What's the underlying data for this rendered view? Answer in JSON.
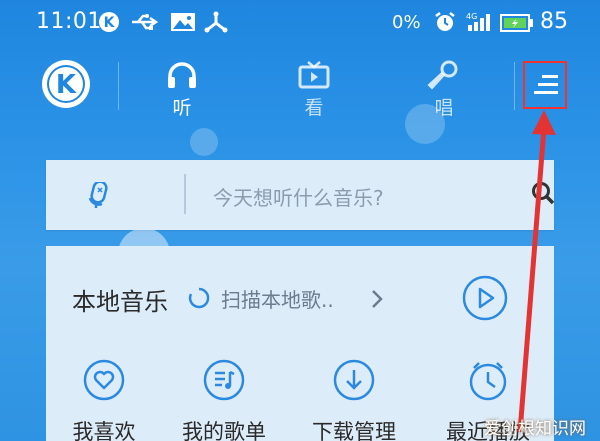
{
  "status_bar": {
    "time": "11:01",
    "data_rate": "0%",
    "battery_level": "85",
    "icons": [
      "k-app-icon",
      "usb-icon",
      "image-icon",
      "share-icon",
      "alarm-icon",
      "signal-4g-icon",
      "battery-icon"
    ]
  },
  "nav": {
    "logo": "K",
    "tabs": [
      {
        "label": "听",
        "icon": "headphones-icon",
        "active": true
      },
      {
        "label": "看",
        "icon": "tv-icon",
        "active": false
      },
      {
        "label": "唱",
        "icon": "microphone-icon",
        "active": false
      }
    ],
    "menu_icon": "menu-icon"
  },
  "search": {
    "placeholder": "今天想听什么音乐?",
    "left_icon": "voice-search-icon",
    "right_icon": "search-icon"
  },
  "local_music": {
    "title": "本地音乐",
    "scan_text": "扫描本地歌..",
    "chevron_icon": "chevron-right-icon",
    "play_icon": "play-circle-icon"
  },
  "quick_actions": [
    {
      "label": "我喜欢",
      "icon": "heart-icon"
    },
    {
      "label": "我的歌单",
      "icon": "playlist-icon"
    },
    {
      "label": "下载管理",
      "icon": "download-icon"
    },
    {
      "label": "最近播放",
      "icon": "clock-icon"
    }
  ],
  "watermark": "爱创根知识网",
  "colors": {
    "header_blue": "#1f86df",
    "card_bg": "#ddecf9",
    "accent_blue": "#2b8ae0",
    "highlight_red": "#e33333"
  }
}
